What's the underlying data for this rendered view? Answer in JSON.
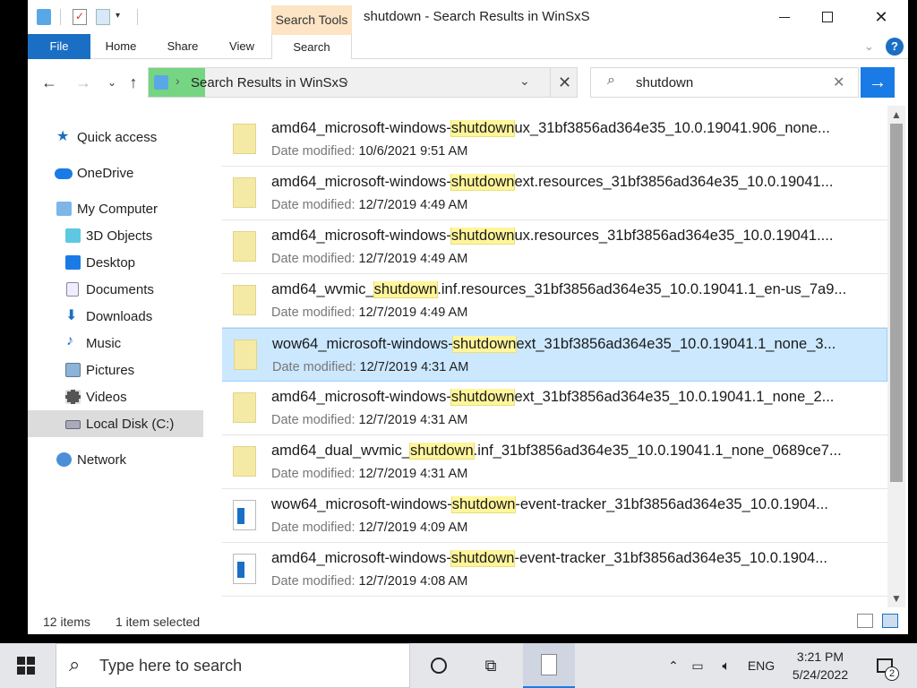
{
  "window": {
    "title": "shutdown - Search Results in WinSxS",
    "context_tab_group": "Search Tools",
    "ribbon_tabs": [
      "File",
      "Home",
      "Share",
      "View",
      "Search"
    ]
  },
  "address": {
    "path": "Search Results in WinSxS"
  },
  "search": {
    "value": "shutdown"
  },
  "sidebar": {
    "items": [
      {
        "label": "Quick access",
        "icon": "star-icon"
      },
      {
        "label": "OneDrive",
        "icon": "cloud-icon"
      },
      {
        "label": "My Computer",
        "icon": "computer-icon"
      },
      {
        "label": "3D Objects",
        "icon": "cube-icon"
      },
      {
        "label": "Desktop",
        "icon": "desktop-icon"
      },
      {
        "label": "Documents",
        "icon": "documents-icon"
      },
      {
        "label": "Downloads",
        "icon": "download-icon"
      },
      {
        "label": "Music",
        "icon": "music-icon"
      },
      {
        "label": "Pictures",
        "icon": "pictures-icon"
      },
      {
        "label": "Videos",
        "icon": "videos-icon"
      },
      {
        "label": "Local Disk (C:)",
        "icon": "disk-icon"
      },
      {
        "label": "Network",
        "icon": "network-icon"
      }
    ]
  },
  "results": {
    "date_label": "Date modified:",
    "items": [
      {
        "pre": "amd64_microsoft-windows-",
        "hl": "shutdown",
        "post": "ux_31bf3856ad364e35_10.0.19041.906_none...",
        "date": "10/6/2021 9:51 AM"
      },
      {
        "pre": "amd64_microsoft-windows-",
        "hl": "shutdown",
        "post": "ext.resources_31bf3856ad364e35_10.0.19041...",
        "date": "12/7/2019 4:49 AM"
      },
      {
        "pre": "amd64_microsoft-windows-",
        "hl": "shutdown",
        "post": "ux.resources_31bf3856ad364e35_10.0.19041....",
        "date": "12/7/2019 4:49 AM"
      },
      {
        "pre": "amd64_wvmic_",
        "hl": "shutdown",
        "post": ".inf.resources_31bf3856ad364e35_10.0.19041.1_en-us_7a9...",
        "date": "12/7/2019 4:49 AM"
      },
      {
        "pre": "wow64_microsoft-windows-",
        "hl": "shutdown",
        "post": "ext_31bf3856ad364e35_10.0.19041.1_none_3...",
        "date": "12/7/2019 4:31 AM"
      },
      {
        "pre": "amd64_microsoft-windows-",
        "hl": "shutdown",
        "post": "ext_31bf3856ad364e35_10.0.19041.1_none_2...",
        "date": "12/7/2019 4:31 AM"
      },
      {
        "pre": "amd64_dual_wvmic_",
        "hl": "shutdown",
        "post": ".inf_31bf3856ad364e35_10.0.19041.1_none_0689ce7...",
        "date": "12/7/2019 4:31 AM"
      },
      {
        "pre": "wow64_microsoft-windows-",
        "hl": "shutdown",
        "post": "-event-tracker_31bf3856ad364e35_10.0.1904...",
        "date": "12/7/2019 4:09 AM"
      },
      {
        "pre": "amd64_microsoft-windows-",
        "hl": "shutdown",
        "post": "-event-tracker_31bf3856ad364e35_10.0.1904...",
        "date": "12/7/2019 4:08 AM"
      }
    ]
  },
  "status": {
    "count": "12 items",
    "selected": "1 item selected"
  },
  "taskbar": {
    "search_placeholder": "Type here to search",
    "lang": "ENG",
    "time": "3:21 PM",
    "date": "5/24/2022",
    "notifications": "2"
  },
  "colors": {
    "accent": "#1a6fc4",
    "highlight": "#fff59b",
    "selected_row": "#cce8ff",
    "context_tab": "#fce4c4"
  }
}
